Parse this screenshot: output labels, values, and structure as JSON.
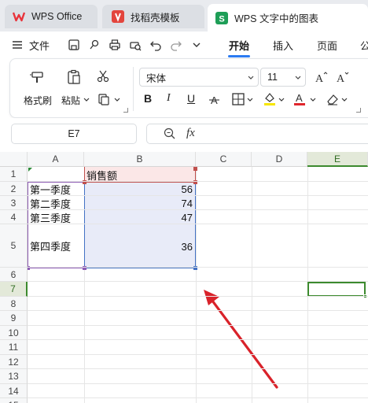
{
  "tabs": [
    {
      "label": "WPS Office"
    },
    {
      "label": "找稻壳模板"
    },
    {
      "label": "WPS 文字中的图表"
    }
  ],
  "menu": {
    "file_label": "文件",
    "tabs": [
      {
        "label": "开始"
      },
      {
        "label": "插入"
      },
      {
        "label": "页面"
      },
      {
        "label": "公"
      }
    ]
  },
  "ribbon": {
    "format_painter_label": "格式刷",
    "paste_label": "粘贴",
    "font_name": "宋体",
    "font_size": "11"
  },
  "formula_bar": {
    "cell_ref": "E7",
    "fx_label": "fx"
  },
  "sheet": {
    "columns": [
      "A",
      "B",
      "C",
      "D",
      "E"
    ],
    "rows": [
      "1",
      "2",
      "3",
      "4",
      "5",
      "6",
      "7",
      "8",
      "9",
      "10",
      "11",
      "12",
      "13",
      "14",
      "15"
    ],
    "header_cell": "销售额",
    "data": [
      {
        "label": "第一季度",
        "value": "56"
      },
      {
        "label": "第二季度",
        "value": "74"
      },
      {
        "label": "第三季度",
        "value": "47"
      },
      {
        "label": "第四季度",
        "value": "36"
      }
    ],
    "selected_cell": "E7"
  },
  "colors": {
    "accent_blue": "#2b7bf2",
    "selection_green": "#3c8a2e",
    "arrow_red": "#d9222a",
    "range_fill": "#e8ebf8",
    "header_fill": "#fbe7e7",
    "range_blue_border": "#4472c4",
    "range_purple_border": "#8e5db5",
    "range_red_border": "#c0504d"
  }
}
